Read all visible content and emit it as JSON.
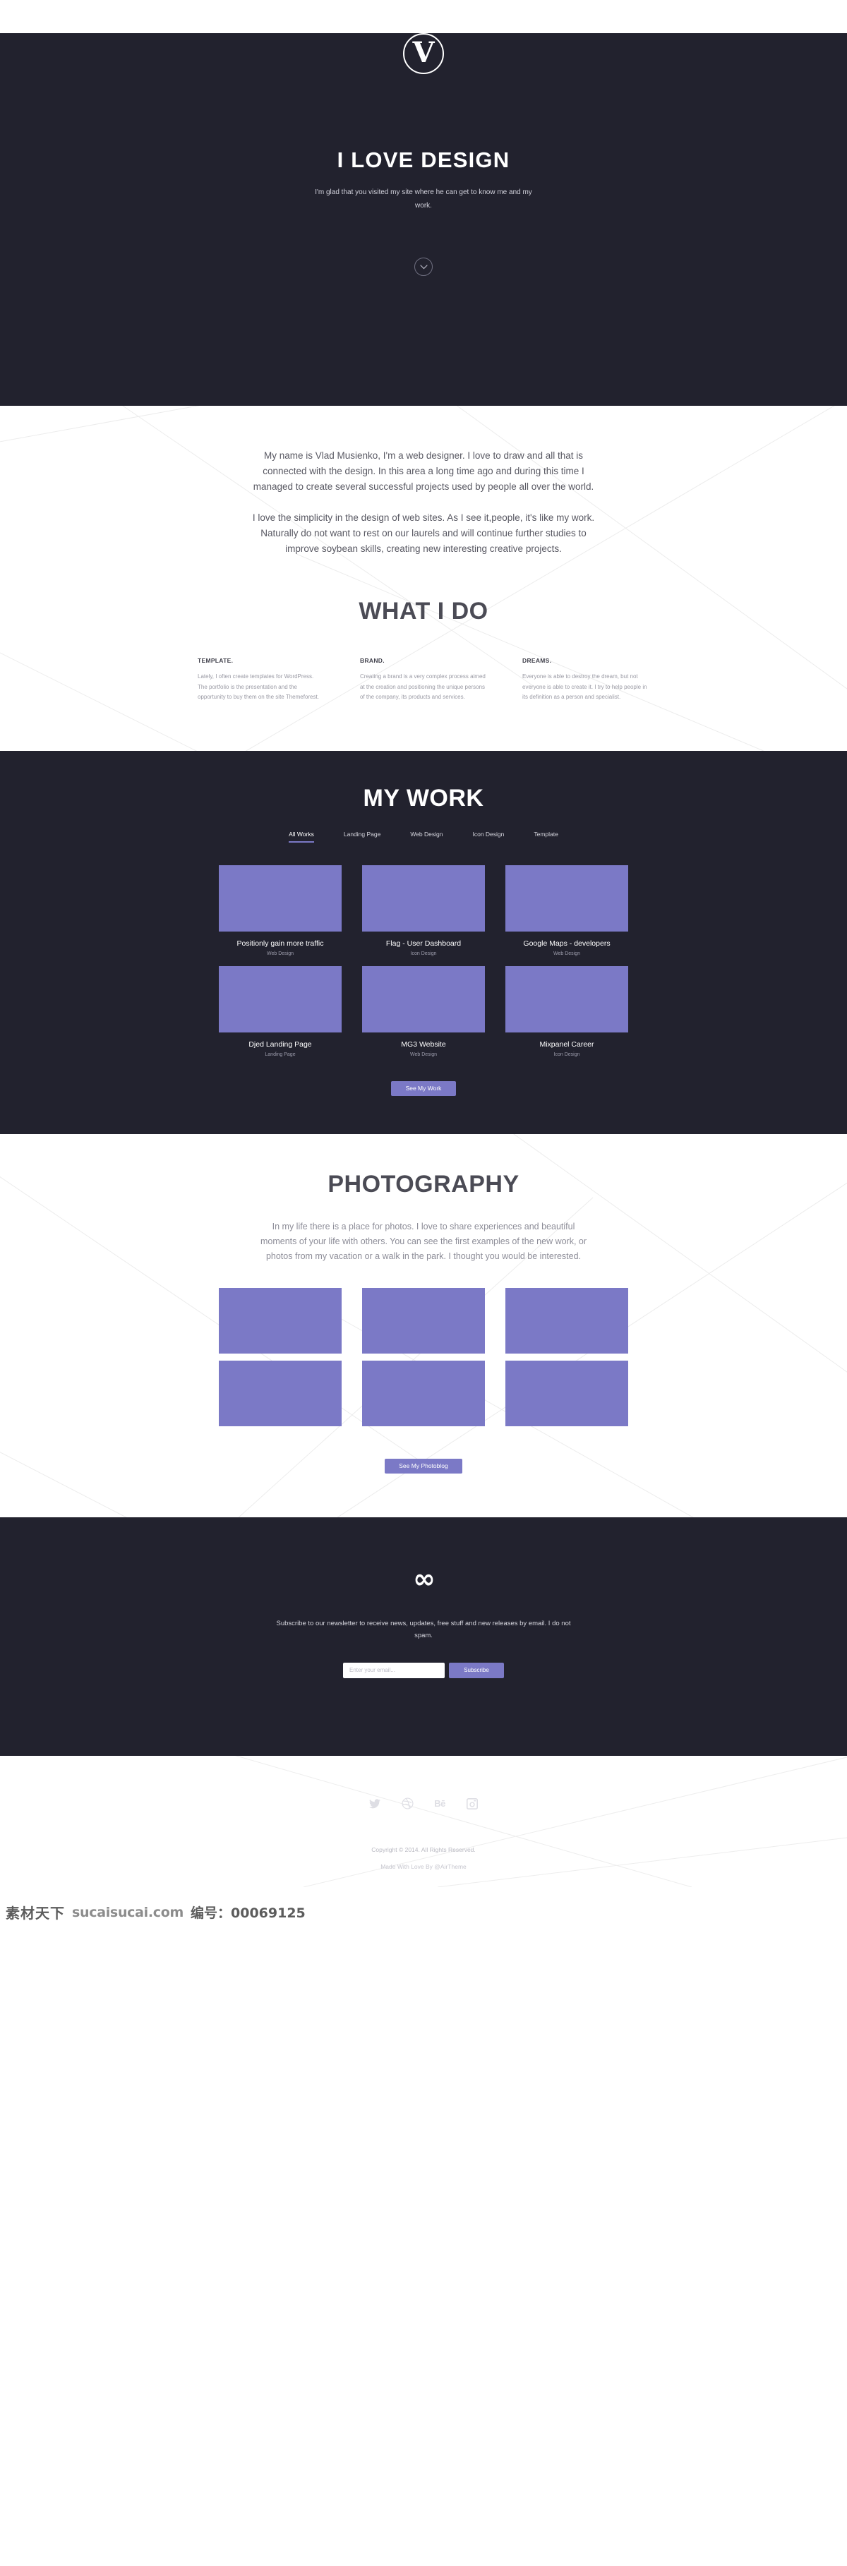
{
  "hero": {
    "logo_letter": "V",
    "title": "I LOVE DESIGN",
    "subtitle": "I'm glad that you visited my site where he can get to know me and my work.",
    "scroll_icon": "chevron-down-icon"
  },
  "about": {
    "paragraph1": "My name is Vlad Musienko, I'm a web designer. I love to draw and all that is connected with the design. In this area a long time ago and during this time I managed to create several successful projects used by people all over the world.",
    "paragraph2": "I love the simplicity in the design of web sites. As I see it,people, it's like my work. Naturally do not want to rest on our laurels and will continue further studies to improve soybean skills, creating new interesting creative projects."
  },
  "whatido": {
    "title": "WHAT I DO",
    "columns": [
      {
        "heading": "TEMPLATE.",
        "body": "Lately, I often create templates for WordPress. The portfolio is the presentation and the opportunity to buy them on the site Themeforest."
      },
      {
        "heading": "BRAND.",
        "body": "Creating a brand is a very complex process aimed at the creation and positioning the unique persons of the company, its products and services."
      },
      {
        "heading": "DREAMS.",
        "body": "Everyone is able to destroy the dream, but not everyone is able to create it. I try to help people in its definition as a person and specialist."
      }
    ]
  },
  "mywork": {
    "title": "MY WORK",
    "filters": [
      {
        "label": "All Works",
        "active": true
      },
      {
        "label": "Landing Page",
        "active": false
      },
      {
        "label": "Web Design",
        "active": false
      },
      {
        "label": "Icon Design",
        "active": false
      },
      {
        "label": "Template",
        "active": false
      }
    ],
    "items": [
      {
        "title": "Positionly gain more traffic",
        "category": "Web Design"
      },
      {
        "title": "Flag - User Dashboard",
        "category": "Icon Design"
      },
      {
        "title": "Google Maps - developers",
        "category": "Web Design"
      },
      {
        "title": "Djed Landing Page",
        "category": "Landing Page"
      },
      {
        "title": "MG3 Website",
        "category": "Web Design"
      },
      {
        "title": "Mixpanel Career",
        "category": "Icon Design"
      }
    ],
    "button_label": "See My Work"
  },
  "photography": {
    "title": "PHOTOGRAPHY",
    "lead": "In my life there is a place for photos. I love to share experiences and beautiful moments of your life with others. You can see the first examples of the new work, or photos from my vacation or a walk in the park. I thought you would be interested.",
    "photos": [
      "photo-1",
      "photo-2",
      "photo-3",
      "photo-4",
      "photo-5",
      "photo-6"
    ],
    "button_label": "See My Photoblog"
  },
  "newsletter": {
    "logo_glyph": "∞",
    "copy": "Subscribe to our newsletter to receive news, updates, free stuff and new releases by email. I do not spam.",
    "email_placeholder": "Enter your email...",
    "email_value": "",
    "button_label": "Subscribe"
  },
  "footer": {
    "socials": [
      {
        "name": "twitter-icon"
      },
      {
        "name": "dribbble-icon"
      },
      {
        "name": "behance-icon",
        "glyph": "Bē"
      },
      {
        "name": "instagram-icon"
      }
    ],
    "copyright": "Copyright © 2014. All Rights Reserved.",
    "madeby": "Made With Love By @AirTheme"
  },
  "watermark": {
    "cn": "素材天下",
    "url": "sucaisucai.com",
    "number": "编号：00069125"
  },
  "colors": {
    "dark_bg": "#22222e",
    "accent": "#7b79c6",
    "light_bg": "#ffffff",
    "muted_text": "#9a9aa4"
  }
}
